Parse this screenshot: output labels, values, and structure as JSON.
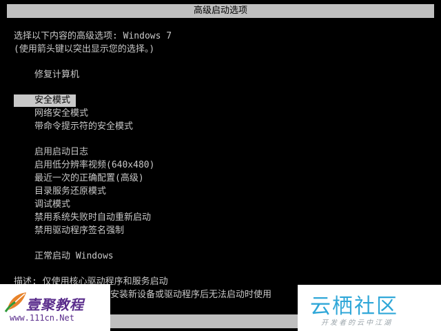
{
  "title": "高级启动选项",
  "prompt": {
    "line1": "选择以下内容的高级选项: Windows 7",
    "line2": "(使用箭头键以突出显示您的选择。)"
  },
  "menu": {
    "repair": "修复计算机",
    "safe_mode": "安全模式",
    "safe_mode_network": "网络安全模式",
    "safe_mode_cmd": "带命令提示符的安全模式",
    "boot_logging": "启用启动日志",
    "low_res_video": "启用低分辨率视频(640x480)",
    "last_known_good": "最近一次的正确配置(高级)",
    "ds_restore": "目录服务还原模式",
    "debugging": "调试模式",
    "disable_auto_restart": "禁用系统失败时自动重新启动",
    "disable_driver_sig": "禁用驱动程序签名强制",
    "start_normally": "正常启动 Windows"
  },
  "description": {
    "line1": "描述: 仅使用核心驱动程序和服务启动",
    "line2": "安装新设备或驱动程序后无法启动时使用"
  },
  "watermark_left": {
    "title": "壹聚教程",
    "url": "www.111cn.Net"
  },
  "watermark_right": {
    "title": "云栖社区",
    "subtitle": "开发者的云中江湖"
  },
  "colors": {
    "background": "#000000",
    "text": "#c8c8c8",
    "highlight": "#c8c8c8",
    "title_bar": "#bfbfbf"
  }
}
